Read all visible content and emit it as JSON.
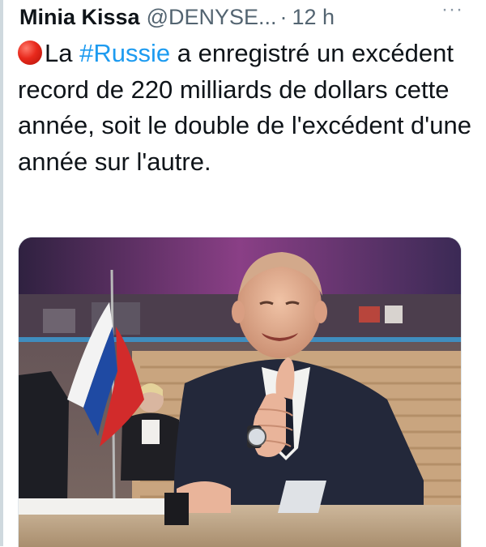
{
  "tweet": {
    "author_name": "Minia Kissa",
    "author_handle": "@DENYSE...",
    "separator": "·",
    "timestamp": "12 h",
    "more_glyph": "···",
    "text_before": "La ",
    "hashtag": "#Russie",
    "text_after": " a enregistré un excédent record de 220 milliards de dollars cette année, soit le double de l'excédent d'une année sur l'autre.",
    "emoji": "red-circle-icon",
    "media": {
      "type": "photo",
      "alt": ""
    }
  },
  "colors": {
    "text": "#0f1419",
    "secondary": "#536471",
    "link": "#1d9bf0",
    "thread_line": "#cfd9de"
  }
}
